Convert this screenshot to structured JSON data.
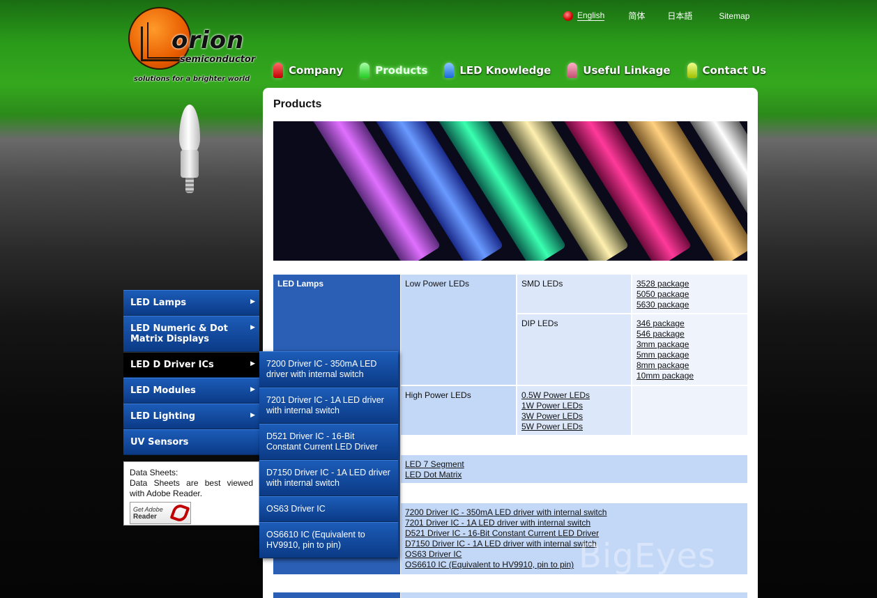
{
  "brand": {
    "name": "orion",
    "sub": "semiconductor",
    "tagline": "solutions for a brighter world"
  },
  "lang": {
    "english": "English",
    "simplified": "简体",
    "japanese": "日本語",
    "sitemap": "Sitemap"
  },
  "nav": {
    "company": "Company",
    "products": "Products",
    "knowledge": "LED Knowledge",
    "linkage": "Useful Linkage",
    "contact": "Contact Us"
  },
  "page": {
    "title": "Products"
  },
  "side": {
    "items": [
      "LED Lamps",
      "LED Numeric & Dot Matrix Displays",
      "LED D Driver ICs",
      "LED Modules",
      "LED Lighting",
      "UV Sensors"
    ],
    "arrow": "▶"
  },
  "submenu": {
    "items": [
      "7200 Driver IC - 350mA LED driver with internal switch",
      "7201 Driver IC - 1A LED driver with internal switch",
      "D521 Driver IC - 16-Bit Constant Current LED Driver",
      "D7150 Driver IC - 1A LED driver with internal switch",
      "OS63 Driver IC",
      "OS6610 IC (Equivalent to HV9910, pin to pin)"
    ]
  },
  "datasheets": {
    "title": "Data Sheets:",
    "text": "Data Sheets are best viewed with Adobe Reader.",
    "adobe_get": "Get Adobe",
    "adobe_reader": "Reader"
  },
  "table": {
    "lamps": "LED Lamps",
    "low_power": "Low Power LEDs",
    "smd": "SMD LEDs",
    "smd_links": [
      "3528 package",
      "5050 package",
      "5630 package"
    ],
    "dip": "DIP LEDs",
    "dip_links": [
      "346 package",
      "546 package",
      "3mm package",
      "5mm package",
      "8mm package",
      "10mm package"
    ],
    "high_power": "High Power LEDs",
    "high_links": [
      "0.5W Power LEDs",
      "1W Power LEDs",
      "3W Power LEDs",
      "5W Power LEDs"
    ],
    "display_links": [
      "LED 7 Segment",
      "LED Dot Matrix"
    ],
    "driver_links": [
      "7200 Driver IC - 350mA LED driver with internal switch",
      "7201 Driver IC - 1A LED driver with internal switch",
      "D521 Driver IC - 16-Bit Constant Current LED Driver",
      "D7150 Driver IC - 1A LED driver with internal switch",
      "OS63 Driver IC",
      "OS6610 IC (Equivalent to HV9910, pin to pin)"
    ]
  },
  "watermark": "BigEyes"
}
